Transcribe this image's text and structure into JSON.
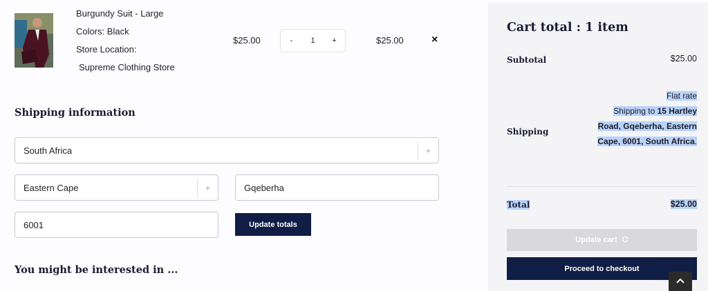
{
  "product": {
    "name": "Burgundy Suit - Large",
    "color": "Colors: Black",
    "store_label": "Store Location:",
    "store_name": "Supreme Clothing Store",
    "price": "$25.00",
    "quantity": "1",
    "minus": "-",
    "plus": "+",
    "line_total": "$25.00",
    "remove": "×"
  },
  "shipping_form": {
    "title": "Shipping information",
    "country": "South Africa",
    "province": "Eastern Cape",
    "city": "Gqeberha",
    "postcode": "6001",
    "update_totals_label": "Update totals"
  },
  "related": {
    "title": "You might be interested in ..."
  },
  "cart_totals": {
    "title": "Cart total : 1 item",
    "subtotal_label": "Subtotal",
    "subtotal_value": "$25.00",
    "shipping_label": "Shipping",
    "shipping_method": "Flat rate",
    "shipping_prefix": "Shipping to",
    "shipping_address": "15 Hartley Road, Gqeberha, Eastern Cape, 6001, South Africa",
    "shipping_suffix": ".",
    "total_label": "Total",
    "total_value": "$25.00",
    "update_cart_label": "Update cart",
    "checkout_label": "Proceed to checkout"
  },
  "icons": {
    "dropdown": "chevron-down-icon",
    "update_cart": "refresh-icon",
    "scroll_top": "chevron-up-icon",
    "remove": "close-icon"
  },
  "colors": {
    "primary": "#101d45",
    "highlight": "#b9d3f7",
    "disabled": "#d9d9dc",
    "panel": "#f4f4f7"
  }
}
